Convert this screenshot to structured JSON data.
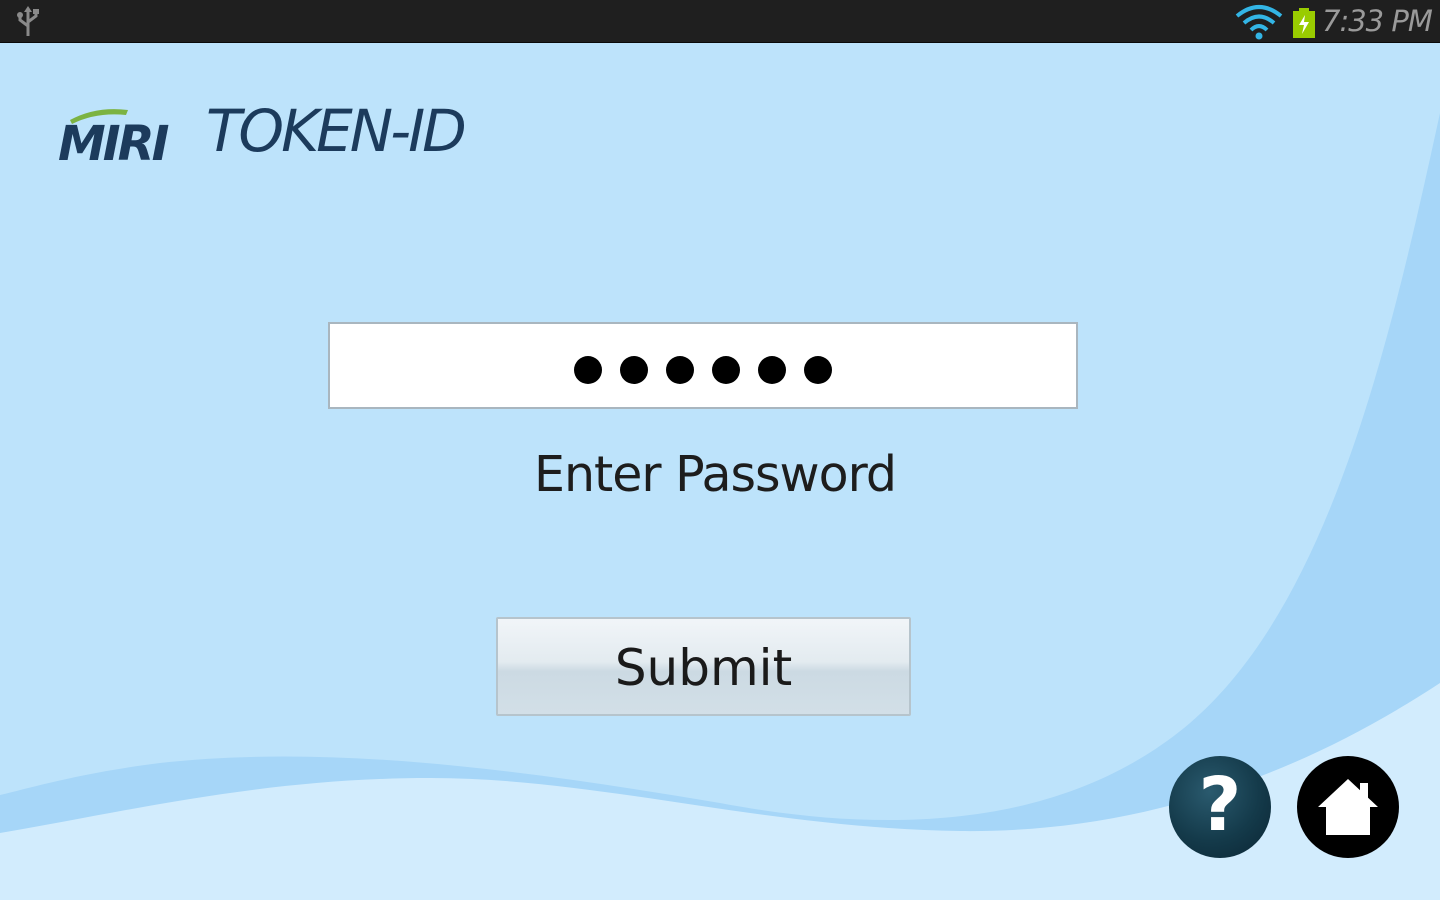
{
  "status_bar": {
    "time": "7:33 PM",
    "icons": [
      "usb-icon",
      "wifi-icon",
      "battery-charging-icon"
    ]
  },
  "logo": {
    "brand": "MIRI",
    "product": "TOKEN-ID"
  },
  "password_field": {
    "masked_value": "••••••",
    "char_count": 6
  },
  "prompt": {
    "label": "Enter Password"
  },
  "actions": {
    "submit_label": "Submit",
    "help_glyph": "?"
  },
  "colors": {
    "background": "#bde3fb",
    "wave_dark": "#a6d6f8",
    "wave_light": "#d2ecfd",
    "status_bar": "#1f1f1f",
    "logo_navy": "#1c3b5c",
    "logo_green": "#7cb342",
    "help_button": "#143a4a"
  }
}
